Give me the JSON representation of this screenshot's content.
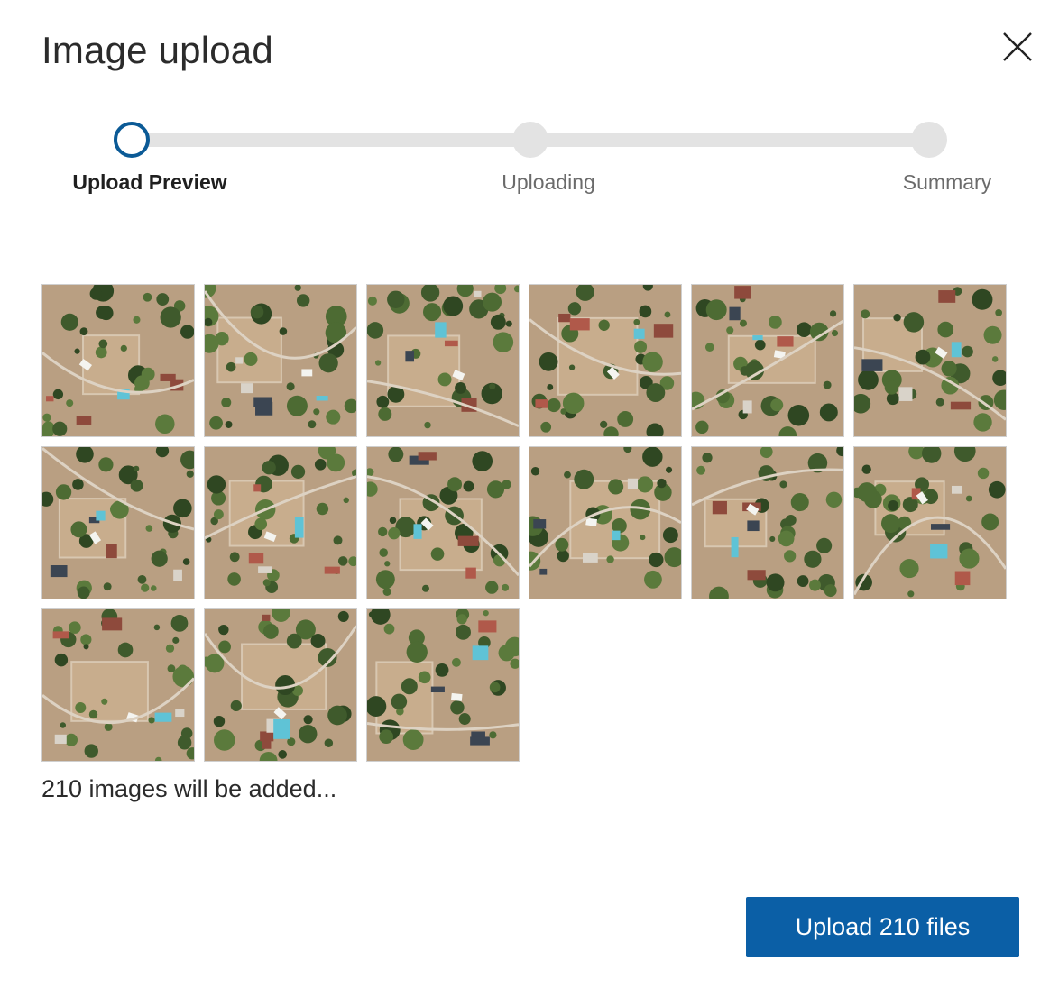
{
  "dialog": {
    "title": "Image upload",
    "close_icon": "close-icon"
  },
  "stepper": {
    "current_step": 1,
    "steps": [
      {
        "label": "Upload Preview",
        "active": true
      },
      {
        "label": "Uploading",
        "active": false
      },
      {
        "label": "Summary",
        "active": false
      }
    ]
  },
  "preview": {
    "thumbnail_count": 15,
    "thumbnail_alt": "aerial photo thumbnail",
    "summary_text": "210 images will be added..."
  },
  "actions": {
    "upload_label": "Upload 210 files"
  },
  "colors": {
    "primary": "#0b5fa6",
    "step_active_ring": "#0b5a96",
    "step_inactive": "#e3e3e3"
  }
}
